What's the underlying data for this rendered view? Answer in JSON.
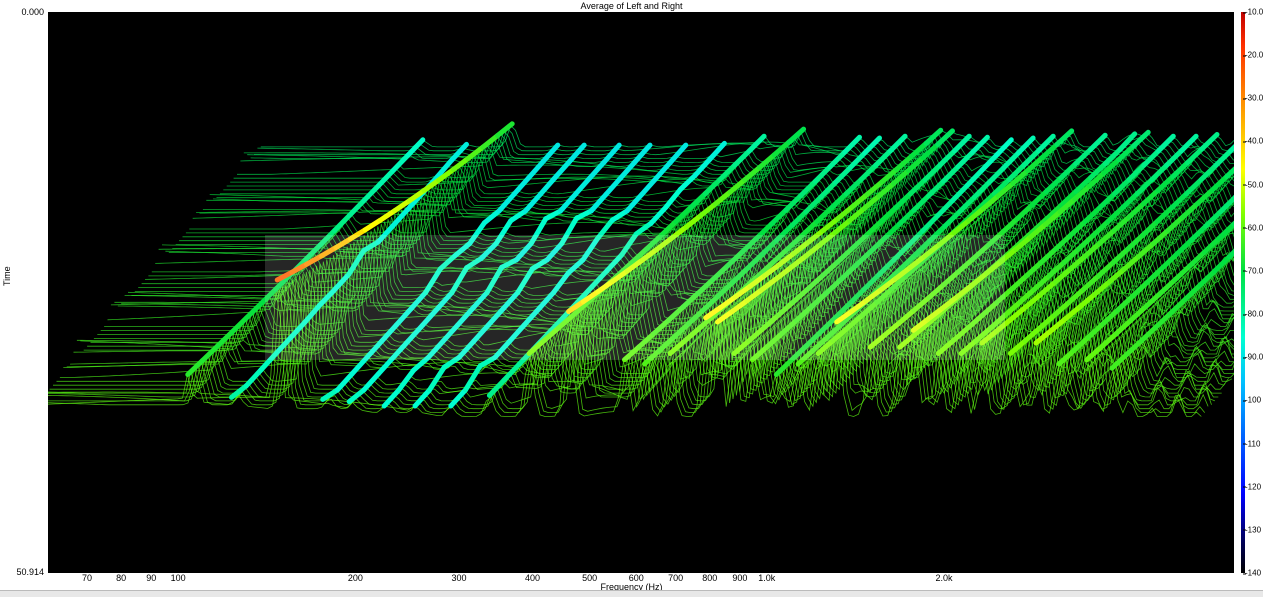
{
  "chart_data": {
    "type": "waterfall",
    "title": "Average of Left and Right",
    "ylabel": "Time",
    "xlabel": "Frequency (Hz)",
    "time_range": [
      "0.000",
      "50.914"
    ],
    "x_scale": "log",
    "x_ticks": [
      "70",
      "80",
      "90",
      "100",
      "200",
      "300",
      "400",
      "500",
      "600",
      "700",
      "800",
      "900",
      "1.0k",
      "2.0k"
    ],
    "colorbar_ticks": [
      "-10.0",
      "-20.0",
      "-30.0",
      "-40.0",
      "-50.0",
      "-60.0",
      "-70.0",
      "-80.0",
      "-90.0",
      "-100",
      "-110",
      "-120",
      "-130",
      "-140"
    ],
    "colorbar_range": [
      -140,
      -10
    ],
    "peaks": [
      {
        "freq": 105,
        "level": -65
      },
      {
        "freq": 125,
        "level": -78
      },
      {
        "freq": 150,
        "level": -20
      },
      {
        "freq": 180,
        "level": -80
      },
      {
        "freq": 200,
        "level": -80
      },
      {
        "freq": 230,
        "level": -80
      },
      {
        "freq": 260,
        "level": -80
      },
      {
        "freq": 300,
        "level": -80
      },
      {
        "freq": 350,
        "level": -75
      },
      {
        "freq": 410,
        "level": -55
      },
      {
        "freq": 480,
        "level": -35
      },
      {
        "freq": 600,
        "level": -58
      },
      {
        "freq": 650,
        "level": -60
      },
      {
        "freq": 720,
        "level": -55
      },
      {
        "freq": 830,
        "level": -38
      },
      {
        "freq": 870,
        "level": -40
      },
      {
        "freq": 930,
        "level": -55
      },
      {
        "freq": 1000,
        "level": -58
      },
      {
        "freq": 1100,
        "level": -65
      },
      {
        "freq": 1200,
        "level": -60
      },
      {
        "freq": 1300,
        "level": -55
      },
      {
        "freq": 1400,
        "level": -40
      },
      {
        "freq": 1600,
        "level": -52
      },
      {
        "freq": 1800,
        "level": -52
      },
      {
        "freq": 1900,
        "level": -44
      },
      {
        "freq": 2100,
        "level": -55
      },
      {
        "freq": 2300,
        "level": -55
      },
      {
        "freq": 2500,
        "level": -50
      },
      {
        "freq": 2800,
        "level": -55
      },
      {
        "freq": 3100,
        "level": -50
      },
      {
        "freq": 3400,
        "level": -60
      },
      {
        "freq": 3800,
        "level": -58
      },
      {
        "freq": 4200,
        "level": -62
      }
    ],
    "noise_floor": -85,
    "grid": false,
    "legend": "colorbar-right"
  }
}
